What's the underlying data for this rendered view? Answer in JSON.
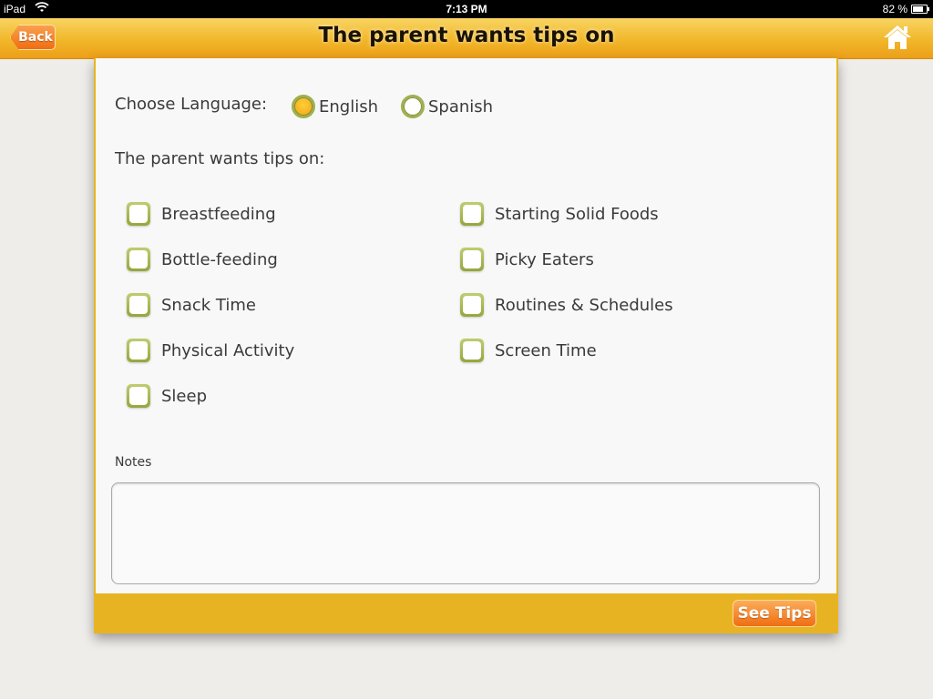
{
  "status_bar": {
    "carrier": "iPad",
    "time": "7:13 PM",
    "battery_percent": "82 %"
  },
  "nav": {
    "title": "The parent wants tips on",
    "back_label": "Back"
  },
  "language": {
    "label": "Choose Language:",
    "options": [
      {
        "label": "English",
        "selected": true
      },
      {
        "label": "Spanish",
        "selected": false
      }
    ]
  },
  "tips": {
    "label": "The parent wants tips on:",
    "left": [
      {
        "label": "Breastfeeding",
        "checked": false
      },
      {
        "label": "Bottle-feeding",
        "checked": false
      },
      {
        "label": "Snack Time",
        "checked": false
      },
      {
        "label": "Physical Activity",
        "checked": false
      },
      {
        "label": "Sleep",
        "checked": false
      }
    ],
    "right": [
      {
        "label": "Starting Solid Foods",
        "checked": false
      },
      {
        "label": "Picky Eaters",
        "checked": false
      },
      {
        "label": "Routines & Schedules",
        "checked": false
      },
      {
        "label": "Screen Time",
        "checked": false
      }
    ]
  },
  "notes": {
    "label": "Notes",
    "value": ""
  },
  "footer": {
    "see_tips_label": "See Tips"
  }
}
